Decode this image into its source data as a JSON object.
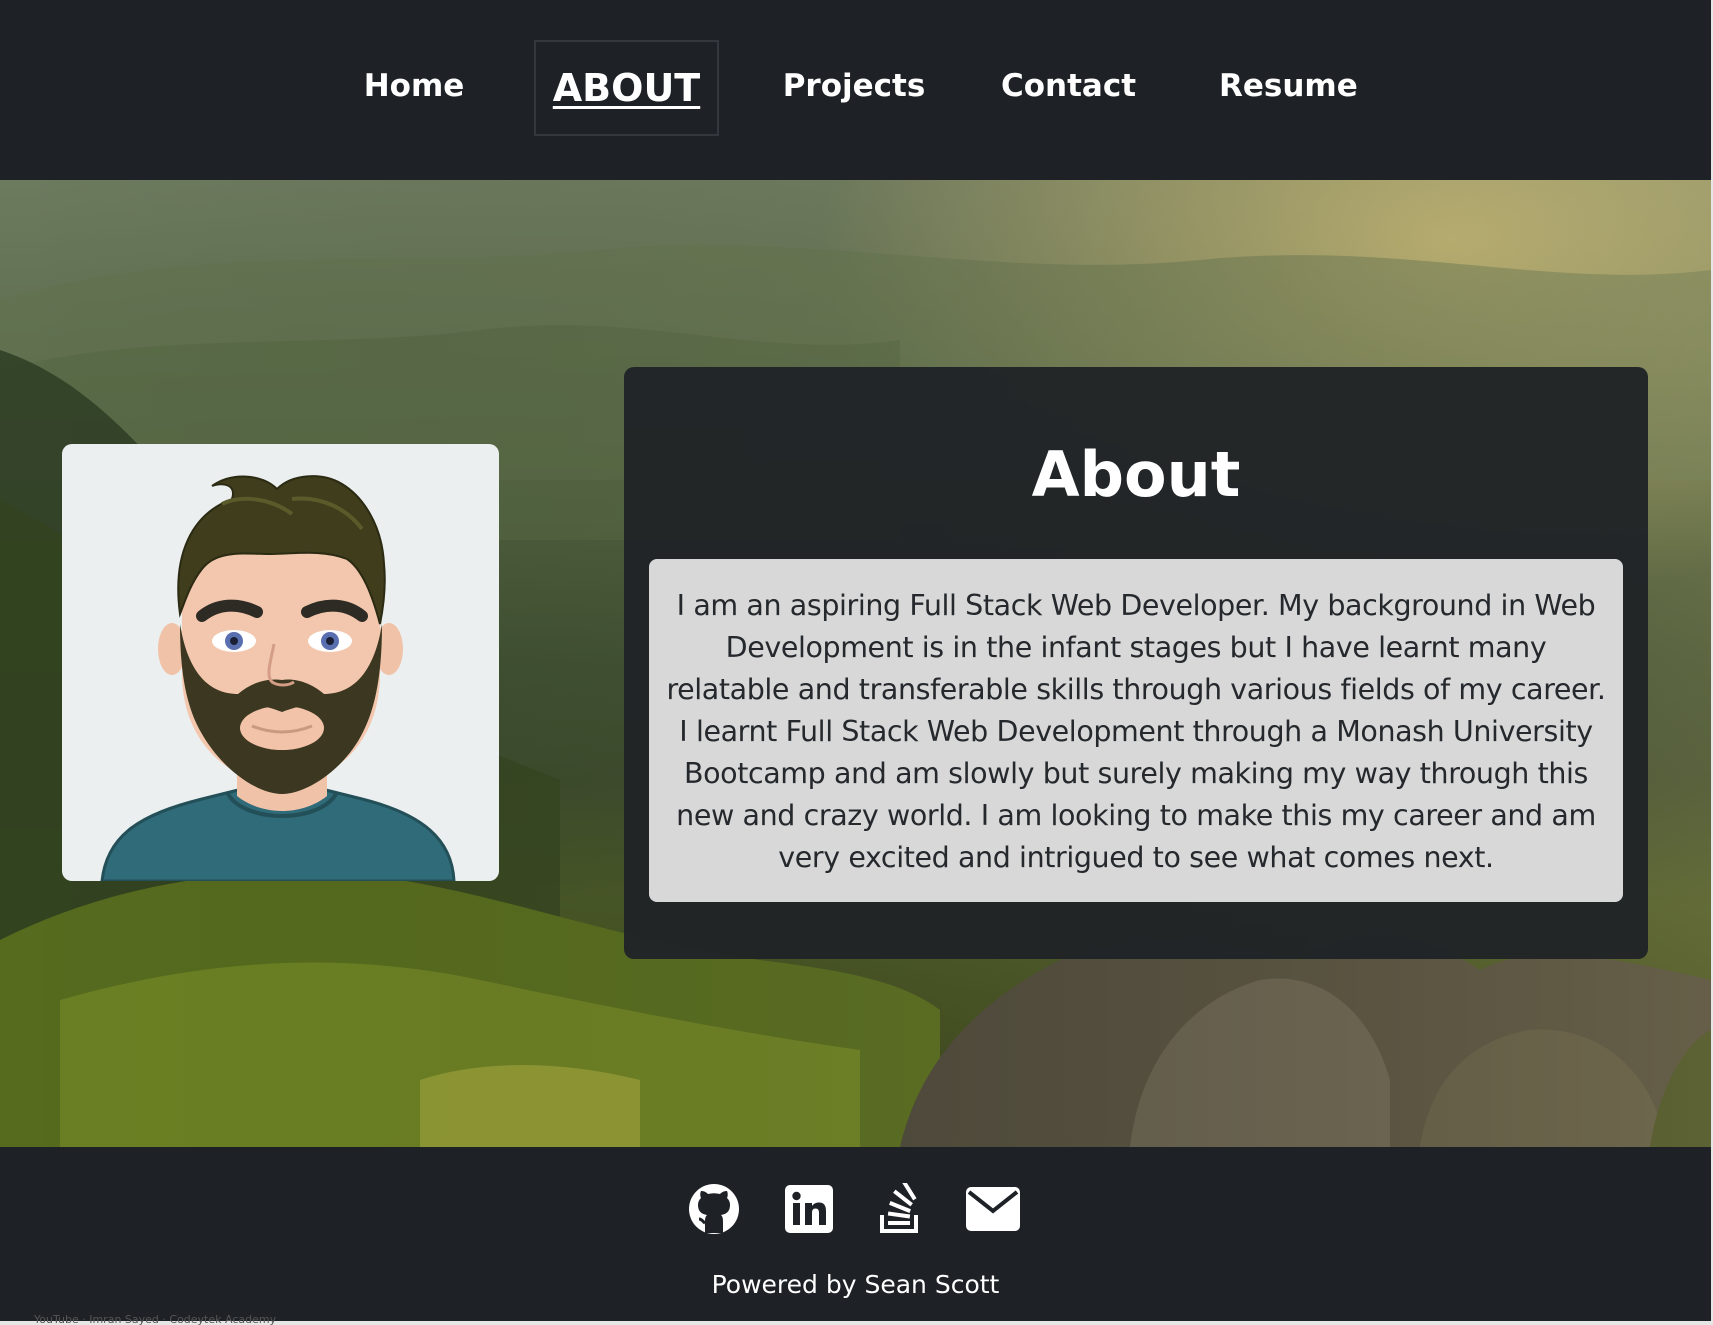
{
  "nav": {
    "items": [
      {
        "label": "Home"
      },
      {
        "label": "ABOUT"
      },
      {
        "label": "Projects"
      },
      {
        "label": "Contact"
      },
      {
        "label": "Resume"
      }
    ],
    "active": "ABOUT"
  },
  "about": {
    "title": "About",
    "body": "I am an aspiring Full Stack Web Developer. My background in Web Development is in the infant stages but I have learnt many relatable and transferable skills through various fields of my career. I learnt Full Stack Web Development through a Monash University Bootcamp and am slowly but surely making my way through this new and crazy world. I am looking to make this my career and am very excited and intrigued to see what comes next.",
    "avatar_icon": "cartoon-avatar-bearded-man"
  },
  "footer": {
    "icons": [
      "github-icon",
      "linkedin-icon",
      "stackoverflow-icon",
      "email-icon"
    ],
    "powered_by": "Powered by Sean Scott"
  },
  "status_bar": {
    "text": "YouTube · Imran Sayed · Codeytek Academy"
  },
  "colors": {
    "header_bg": "#1e2227",
    "panel_bg": "#202327",
    "text_box_bg": "#d8d8d8",
    "nav_text": "#ffffff"
  }
}
